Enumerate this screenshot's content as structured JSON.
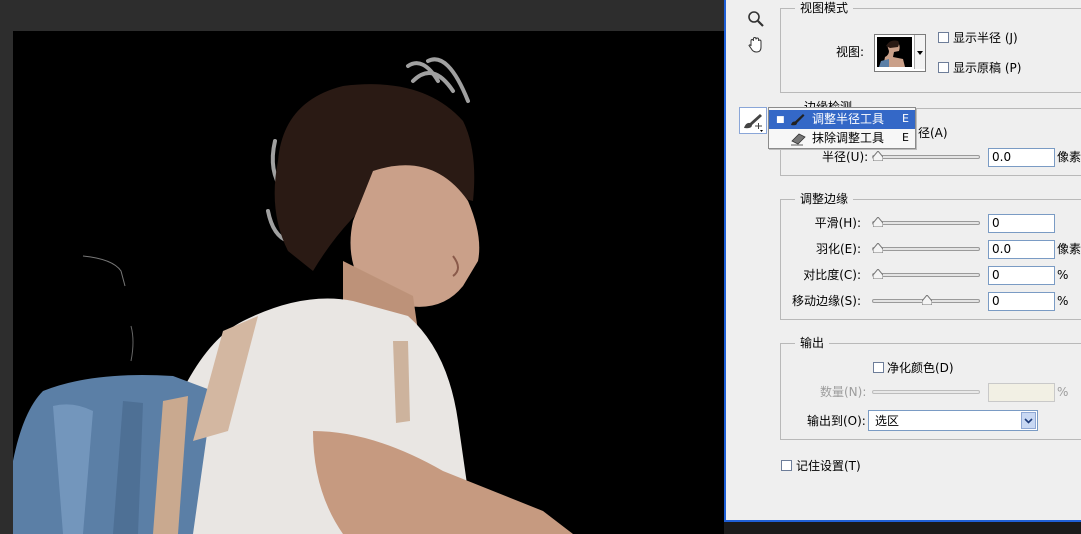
{
  "tools": [
    "zoom-tool",
    "hand-tool",
    "refine-radius-tool"
  ],
  "view_mode": {
    "title": "视图模式",
    "view_label": "视图:",
    "show_radius": "显示半径 (J)",
    "show_original": "显示原稿 (P)"
  },
  "edge_detection": {
    "title_partial": "边缘检测",
    "smart_radius_partial": "径(A)",
    "radius_label": "半径(U):",
    "radius_value": "0.0",
    "radius_unit": "像素",
    "radius_level": 0
  },
  "adjust_edge": {
    "title": "调整边缘",
    "rows": [
      {
        "label": "平滑(H):",
        "value": "0",
        "unit": "",
        "level": 0
      },
      {
        "label": "羽化(E):",
        "value": "0.0",
        "unit": "像素",
        "level": 0
      },
      {
        "label": "对比度(C):",
        "value": "0",
        "unit": "%",
        "level": 0
      },
      {
        "label": "移动边缘(S):",
        "value": "0",
        "unit": "%",
        "level": 0.5
      }
    ]
  },
  "output": {
    "title": "输出",
    "decontaminate": "净化颜色(D)",
    "amount_label": "数量(N):",
    "amount_unit": "%",
    "output_to_label": "输出到(O):",
    "output_to_value": "选区"
  },
  "remember": "记住设置(T)",
  "tool_menu": {
    "items": [
      {
        "label": "调整半径工具",
        "shortcut": "E",
        "selected": true,
        "icon": "brush-icon"
      },
      {
        "label": "抹除调整工具",
        "shortcut": "E",
        "selected": false,
        "icon": "eraser-icon"
      }
    ]
  },
  "colors": {
    "accent": "#3468c7",
    "dialog_border": "#1f5fd6",
    "canvas": "#000000"
  }
}
